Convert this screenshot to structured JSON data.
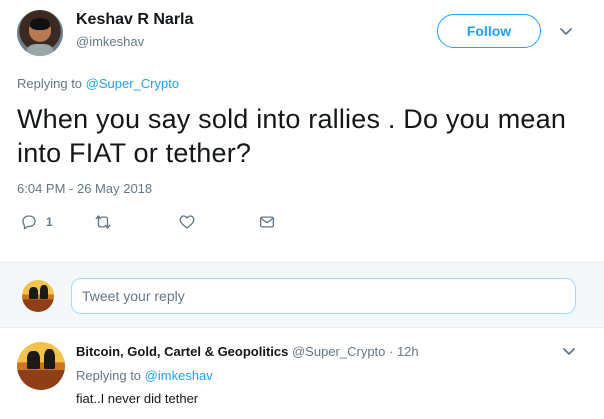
{
  "tweet": {
    "author_name": "Keshav R Narla",
    "author_handle": "@imkeshav",
    "follow_label": "Follow",
    "replying_label": "Replying to",
    "replying_handle": "@Super_Crypto",
    "text": "When you say sold into rallies . Do you mean into FIAT or tether?",
    "timestamp": "6:04 PM - 26 May 2018",
    "reply_count": "1"
  },
  "compose": {
    "placeholder": "Tweet your reply"
  },
  "reply": {
    "author_name": "Bitcoin, Gold, Cartel & Geopolitics",
    "meta": "@Super_Crypto · 12h",
    "replying_label": "Replying to",
    "replying_handle": "@imkeshav",
    "text": "fiat..I never did tether"
  },
  "colors": {
    "accent": "#1da1f2",
    "muted": "#657786",
    "text": "#14171a",
    "compose_bg": "#f5f8fa"
  },
  "icons": [
    "reply-icon",
    "retweet-icon",
    "like-icon",
    "direct-message-icon",
    "caret-down-icon"
  ]
}
